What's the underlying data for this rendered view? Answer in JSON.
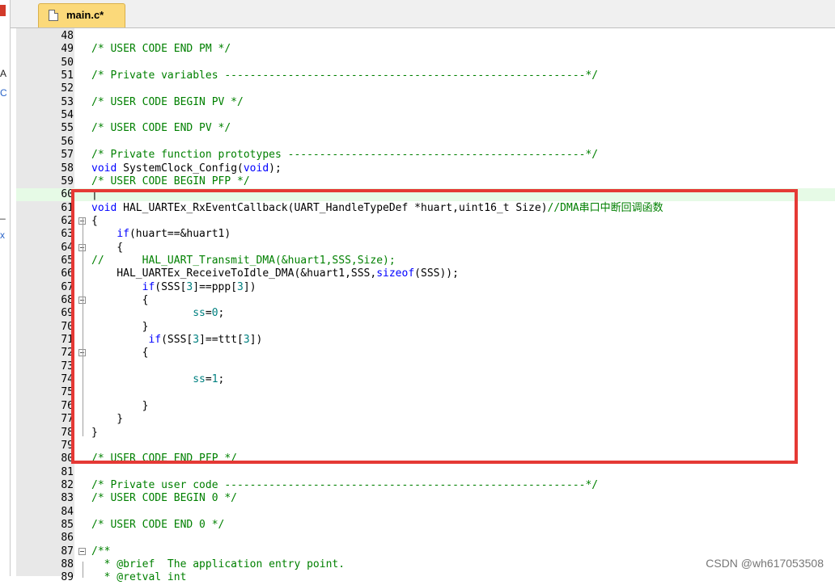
{
  "tabs": [
    {
      "label": "main.c*",
      "active": true
    }
  ],
  "left_panel": {
    "chars": [
      "A",
      "C",
      "_",
      "x"
    ]
  },
  "lines": [
    {
      "n": "48",
      "fold": false,
      "segs": []
    },
    {
      "n": "49",
      "fold": false,
      "segs": [
        {
          "t": "/* USER CODE END PM */",
          "c": "cm"
        }
      ]
    },
    {
      "n": "50",
      "fold": false,
      "segs": []
    },
    {
      "n": "51",
      "fold": false,
      "segs": [
        {
          "t": "/* Private variables ---------------------------------------------------------*/",
          "c": "cm"
        }
      ]
    },
    {
      "n": "52",
      "fold": false,
      "segs": []
    },
    {
      "n": "53",
      "fold": false,
      "segs": [
        {
          "t": "/* USER CODE BEGIN PV */",
          "c": "cm"
        }
      ]
    },
    {
      "n": "54",
      "fold": false,
      "segs": []
    },
    {
      "n": "55",
      "fold": false,
      "segs": [
        {
          "t": "/* USER CODE END PV */",
          "c": "cm"
        }
      ]
    },
    {
      "n": "56",
      "fold": false,
      "segs": []
    },
    {
      "n": "57",
      "fold": false,
      "segs": [
        {
          "t": "/* Private function prototypes -----------------------------------------------*/",
          "c": "cm"
        }
      ]
    },
    {
      "n": "58",
      "fold": false,
      "segs": [
        {
          "t": "void",
          "c": "kw"
        },
        {
          "t": " SystemClock_Config(",
          "c": ""
        },
        {
          "t": "void",
          "c": "kw"
        },
        {
          "t": ");",
          "c": ""
        }
      ]
    },
    {
      "n": "59",
      "fold": false,
      "segs": [
        {
          "t": "/* USER CODE BEGIN PFP */",
          "c": "cm"
        }
      ]
    },
    {
      "n": "60",
      "fold": false,
      "cur": true,
      "segs": [
        {
          "t": "|",
          "c": ""
        }
      ]
    },
    {
      "n": "61",
      "fold": false,
      "segs": [
        {
          "t": "void",
          "c": "kw"
        },
        {
          "t": " HAL_UARTEx_RxEventCallback(UART_HandleTypeDef *huart,uint16_t Size)",
          "c": ""
        },
        {
          "t": "//DMA串口中断回调函数",
          "c": "cm"
        }
      ]
    },
    {
      "n": "62",
      "fold": true,
      "segs": [
        {
          "t": "{",
          "c": ""
        }
      ]
    },
    {
      "n": "63",
      "fold": false,
      "segs": [
        {
          "t": "    ",
          "c": ""
        },
        {
          "t": "if",
          "c": "kw"
        },
        {
          "t": "(huart==&huart1)",
          "c": ""
        }
      ]
    },
    {
      "n": "64",
      "fold": true,
      "segs": [
        {
          "t": "    {",
          "c": ""
        }
      ]
    },
    {
      "n": "65",
      "fold": false,
      "segs": [
        {
          "t": "//      HAL_UART_Transmit_DMA(&huart1,SSS,Size);",
          "c": "cm"
        }
      ]
    },
    {
      "n": "66",
      "fold": false,
      "segs": [
        {
          "t": "    HAL_UARTEx_ReceiveToIdle_DMA(&huart1,SSS,",
          "c": ""
        },
        {
          "t": "sizeof",
          "c": "kw"
        },
        {
          "t": "(SSS));",
          "c": ""
        }
      ]
    },
    {
      "n": "67",
      "fold": false,
      "segs": [
        {
          "t": "        ",
          "c": ""
        },
        {
          "t": "if",
          "c": "kw"
        },
        {
          "t": "(SSS[",
          "c": ""
        },
        {
          "t": "3",
          "c": "nm"
        },
        {
          "t": "]==ppp[",
          "c": ""
        },
        {
          "t": "3",
          "c": "nm"
        },
        {
          "t": "])",
          "c": ""
        }
      ]
    },
    {
      "n": "68",
      "fold": true,
      "segs": [
        {
          "t": "        {",
          "c": ""
        }
      ]
    },
    {
      "n": "69",
      "fold": false,
      "segs": [
        {
          "t": "                ",
          "c": ""
        },
        {
          "t": "ss",
          "c": "nm"
        },
        {
          "t": "=",
          "c": ""
        },
        {
          "t": "0",
          "c": "nm"
        },
        {
          "t": ";",
          "c": ""
        }
      ]
    },
    {
      "n": "70",
      "fold": false,
      "segs": [
        {
          "t": "        }",
          "c": ""
        }
      ]
    },
    {
      "n": "71",
      "fold": false,
      "segs": [
        {
          "t": "         ",
          "c": ""
        },
        {
          "t": "if",
          "c": "kw"
        },
        {
          "t": "(SSS[",
          "c": ""
        },
        {
          "t": "3",
          "c": "nm"
        },
        {
          "t": "]==ttt[",
          "c": ""
        },
        {
          "t": "3",
          "c": "nm"
        },
        {
          "t": "])",
          "c": ""
        }
      ]
    },
    {
      "n": "72",
      "fold": true,
      "segs": [
        {
          "t": "        {",
          "c": ""
        }
      ]
    },
    {
      "n": "73",
      "fold": false,
      "segs": []
    },
    {
      "n": "74",
      "fold": false,
      "segs": [
        {
          "t": "                ",
          "c": ""
        },
        {
          "t": "ss",
          "c": "nm"
        },
        {
          "t": "=",
          "c": ""
        },
        {
          "t": "1",
          "c": "nm"
        },
        {
          "t": ";",
          "c": ""
        }
      ]
    },
    {
      "n": "75",
      "fold": false,
      "segs": []
    },
    {
      "n": "76",
      "fold": false,
      "segs": [
        {
          "t": "        }",
          "c": ""
        }
      ]
    },
    {
      "n": "77",
      "fold": false,
      "segs": [
        {
          "t": "    }",
          "c": ""
        }
      ]
    },
    {
      "n": "78",
      "fold": false,
      "segs": [
        {
          "t": "}",
          "c": ""
        }
      ]
    },
    {
      "n": "79",
      "fold": false,
      "segs": []
    },
    {
      "n": "80",
      "fold": false,
      "segs": [
        {
          "t": "/* USER CODE END PFP */",
          "c": "cm"
        }
      ]
    },
    {
      "n": "81",
      "fold": false,
      "segs": []
    },
    {
      "n": "82",
      "fold": false,
      "segs": [
        {
          "t": "/* Private user code ---------------------------------------------------------*/",
          "c": "cm"
        }
      ]
    },
    {
      "n": "83",
      "fold": false,
      "segs": [
        {
          "t": "/* USER CODE BEGIN 0 */",
          "c": "cm"
        }
      ]
    },
    {
      "n": "84",
      "fold": false,
      "segs": []
    },
    {
      "n": "85",
      "fold": false,
      "segs": [
        {
          "t": "/* USER CODE END 0 */",
          "c": "cm"
        }
      ]
    },
    {
      "n": "86",
      "fold": false,
      "segs": []
    },
    {
      "n": "87",
      "fold": true,
      "segs": [
        {
          "t": "/**",
          "c": "cm"
        }
      ]
    },
    {
      "n": "88",
      "fold": false,
      "segs": [
        {
          "t": "  * @brief  The application entry point.",
          "c": "cm"
        }
      ]
    },
    {
      "n": "89",
      "fold": false,
      "segs": [
        {
          "t": "  * @retval int",
          "c": "cm"
        }
      ]
    }
  ],
  "watermark": "CSDN @wh617053508",
  "colors": {
    "comment": "#008000",
    "keyword": "#0000ff",
    "number": "#008080",
    "highlight_border": "#e53935",
    "tab": "#fbd97a"
  }
}
